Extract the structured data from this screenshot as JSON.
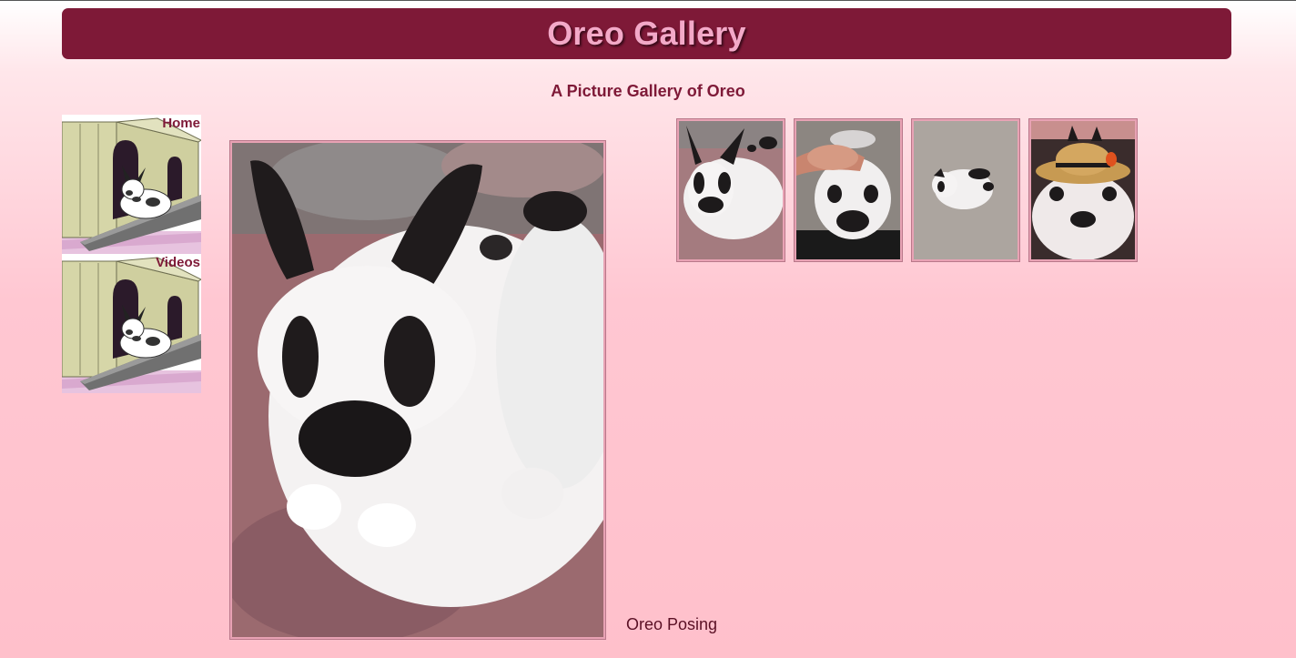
{
  "header": {
    "title": "Oreo Gallery"
  },
  "subtitle": "A Picture Gallery of Oreo",
  "nav": [
    {
      "label": "Home"
    },
    {
      "label": "Videos"
    }
  ],
  "main_image": {
    "caption": "Oreo Posing"
  },
  "colors": {
    "header_bg": "#7e1937",
    "header_text": "#f3a9c8",
    "page_bg": "#ffc0cb",
    "accent_text": "#7e1937"
  }
}
